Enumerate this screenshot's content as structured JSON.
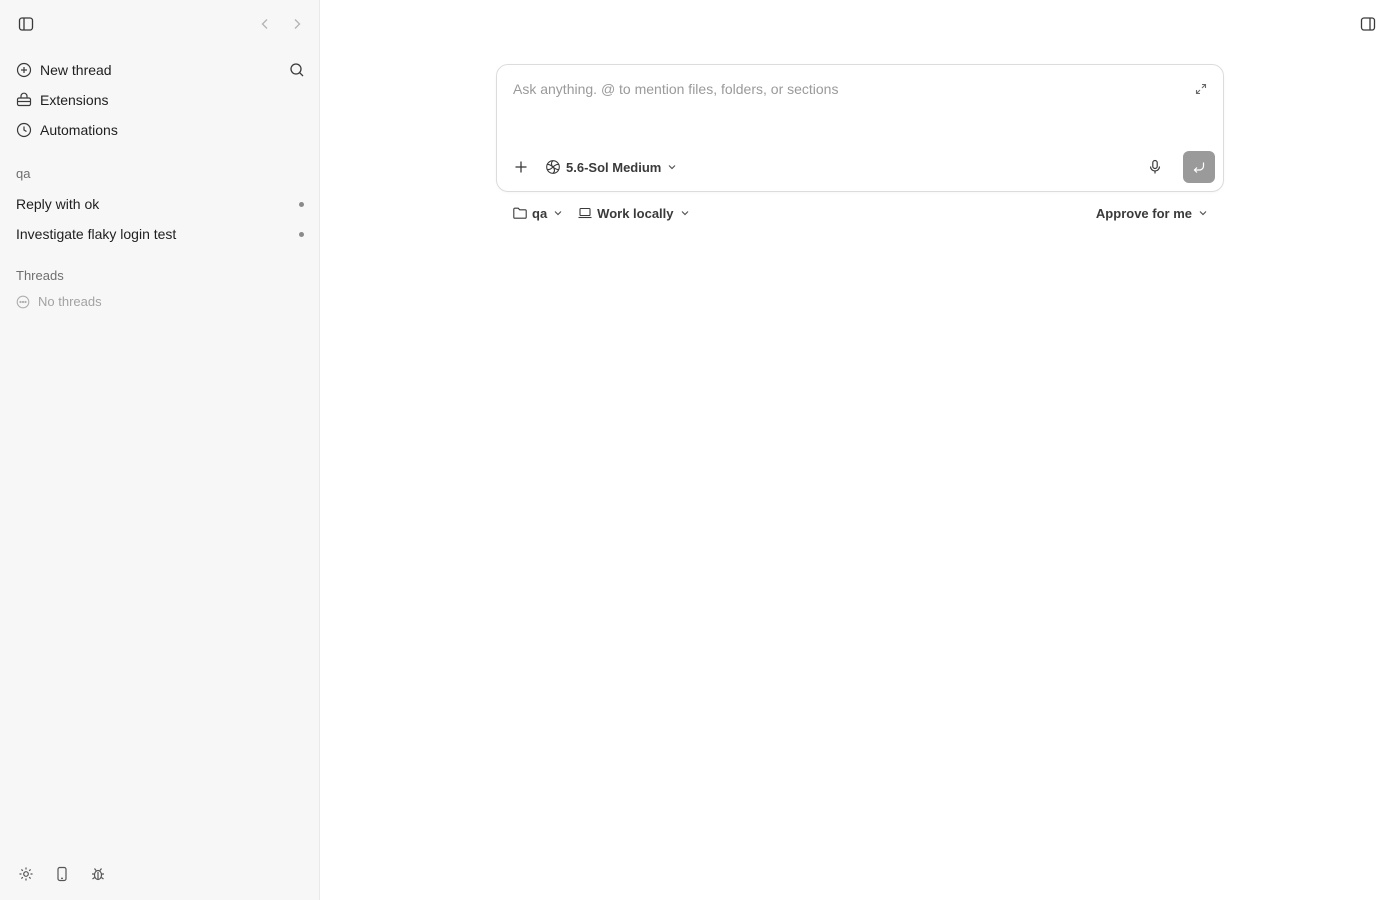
{
  "sidebar": {
    "nav": [
      {
        "label": "New thread",
        "icon": "plus-circle-icon"
      },
      {
        "label": "Extensions",
        "icon": "extensions-icon"
      },
      {
        "label": "Automations",
        "icon": "clock-icon"
      }
    ],
    "project_label": "qa",
    "project_threads": [
      {
        "title": "Reply with ok"
      },
      {
        "title": "Investigate flaky login test"
      }
    ],
    "threads_label": "Threads",
    "threads_empty": "No threads"
  },
  "composer": {
    "placeholder": "Ask anything. @ to mention files, folders, or sections",
    "model": "5.6-Sol Medium",
    "send_color": "#9a9a9a"
  },
  "options": {
    "folder": "qa",
    "environment": "Work locally",
    "approval": "Approve for me"
  }
}
